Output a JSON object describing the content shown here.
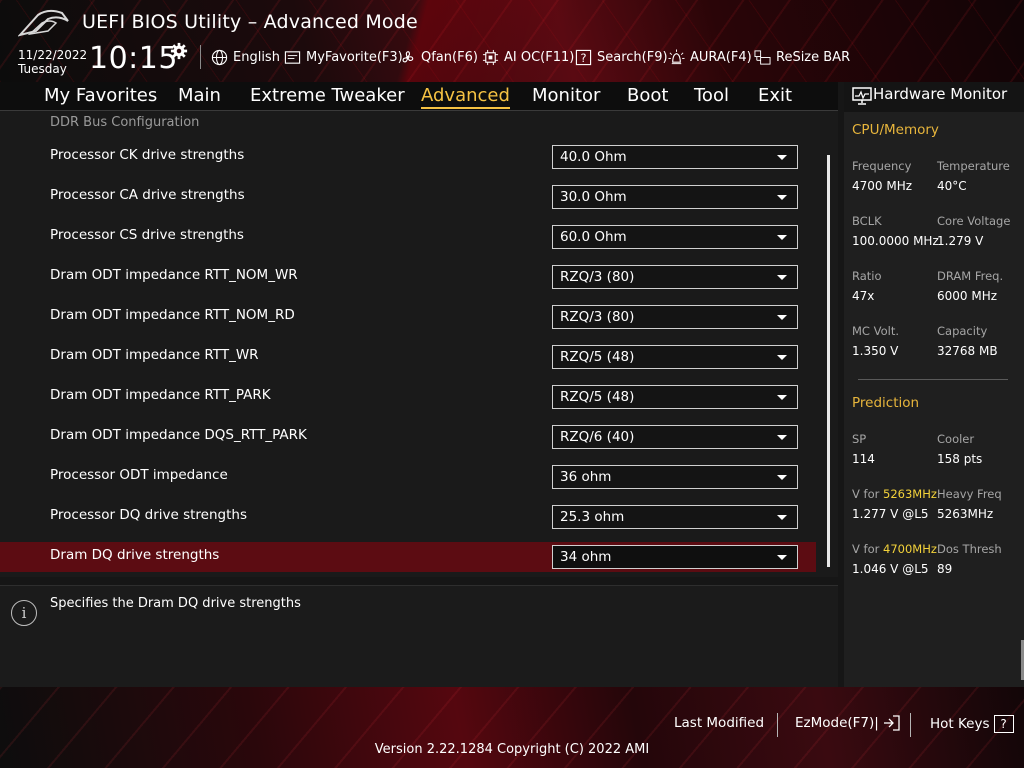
{
  "app": {
    "title": "UEFI BIOS Utility – Advanced Mode"
  },
  "clock": {
    "date": "11/22/2022",
    "day": "Tuesday",
    "time": "10:15"
  },
  "toolbar": {
    "english": "English",
    "myfavorite": "MyFavorite(F3)",
    "qfan": "Qfan(F6)",
    "aioc": "AI OC(F11)",
    "search": "Search(F9)",
    "aura": "AURA(F4)",
    "resizebar": "ReSize BAR"
  },
  "menu": {
    "items": [
      "My Favorites",
      "Main",
      "Extreme Tweaker",
      "Advanced",
      "Monitor",
      "Boot",
      "Tool",
      "Exit"
    ],
    "active": "Advanced"
  },
  "main": {
    "section": "DDR Bus Configuration",
    "rows": [
      {
        "label": "Processor CK drive strengths",
        "value": "40.0 Ohm"
      },
      {
        "label": "Processor CA drive strengths",
        "value": "30.0 Ohm"
      },
      {
        "label": "Processor CS drive strengths",
        "value": "60.0 Ohm"
      },
      {
        "label": "Dram ODT impedance RTT_NOM_WR",
        "value": "RZQ/3 (80)"
      },
      {
        "label": "Dram ODT impedance RTT_NOM_RD",
        "value": "RZQ/3 (80)"
      },
      {
        "label": "Dram ODT impedance RTT_WR",
        "value": "RZQ/5 (48)"
      },
      {
        "label": "Dram ODT impedance RTT_PARK",
        "value": "RZQ/5 (48)"
      },
      {
        "label": "Dram ODT impedance DQS_RTT_PARK",
        "value": "RZQ/6 (40)"
      },
      {
        "label": "Processor ODT impedance",
        "value": "36 ohm"
      },
      {
        "label": "Processor DQ drive strengths",
        "value": "25.3 ohm"
      },
      {
        "label": "Dram DQ drive strengths",
        "value": "34 ohm"
      }
    ],
    "selected": "Dram DQ drive strengths"
  },
  "help": {
    "text": "Specifies the Dram DQ drive strengths"
  },
  "hw": {
    "title": "Hardware Monitor",
    "cpu_section": "CPU/Memory",
    "frequency_label": "Frequency",
    "frequency_value": "4700 MHz",
    "temperature_label": "Temperature",
    "temperature_value": "40°C",
    "bclk_label": "BCLK",
    "bclk_value": "100.0000 MHz",
    "corevolt_label": "Core Voltage",
    "corevolt_value": "1.279 V",
    "ratio_label": "Ratio",
    "ratio_value": "47x",
    "dramfreq_label": "DRAM Freq.",
    "dramfreq_value": "6000 MHz",
    "mcvolt_label": "MC Volt.",
    "mcvolt_value": "1.350 V",
    "capacity_label": "Capacity",
    "capacity_value": "32768 MB",
    "prediction_section": "Prediction",
    "sp_label": "SP",
    "sp_value": "114",
    "cooler_label": "Cooler",
    "cooler_value": "158 pts",
    "vfor1_prefix": "V for ",
    "vfor1_freq": "5263MHz",
    "vfor1_value": "1.277 V @L5",
    "heavyfreq_label": "Heavy Freq",
    "heavyfreq_value": "5263MHz",
    "vfor2_prefix": "V for ",
    "vfor2_freq": "4700MHz",
    "vfor2_value": "1.046 V @L5",
    "dosthresh_label": "Dos Thresh",
    "dosthresh_value": "89"
  },
  "footer": {
    "last_modified": "Last Modified",
    "ezmode": "EzMode(F7)|",
    "hotkeys": "Hot Keys",
    "hotkeys_icon": "?",
    "version": "Version 2.22.1284 Copyright (C) 2022 AMI"
  },
  "colors": {
    "accent": "#f6c243",
    "highlight_row": "#5c0c12",
    "section": "#e7b53c",
    "value_highlight": "#f3d23a"
  },
  "icons": [
    "rog-logo",
    "gear-icon",
    "globe-icon",
    "favorite-icon",
    "fan-icon",
    "aioc-icon",
    "search-icon",
    "aura-icon",
    "resizebar-icon",
    "monitor-icon",
    "info-icon",
    "exit-icon",
    "hotkey-icon",
    "caret-icon"
  ]
}
